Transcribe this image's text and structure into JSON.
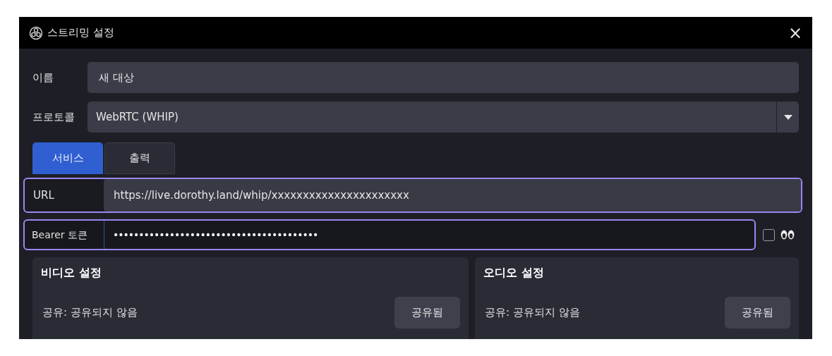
{
  "window": {
    "title": "스트리밍 설정",
    "close": "×"
  },
  "name_field": {
    "label": "이름",
    "value": "새 대상"
  },
  "protocol_field": {
    "label": "프로토콜",
    "value": "WebRTC (WHIP)"
  },
  "tabs": [
    {
      "label": "서비스",
      "selected": true
    },
    {
      "label": "출력",
      "selected": false
    }
  ],
  "url_field": {
    "label": "URL",
    "value": "https://live.dorothy.land/whip/xxxxxxxxxxxxxxxxxxxxxx"
  },
  "token_field": {
    "label": "Bearer 토큰",
    "value": "••••••••••••••••••••••••••••••••••••••••",
    "show_checkbox": {
      "checked": false
    }
  },
  "panels": [
    {
      "title": "비디오 설정",
      "status": "공유: 공유되지 않음",
      "button": "공유됨"
    },
    {
      "title": "오디오 설정",
      "status": "공유: 공유되지 않음",
      "button": "공유됨"
    }
  ]
}
